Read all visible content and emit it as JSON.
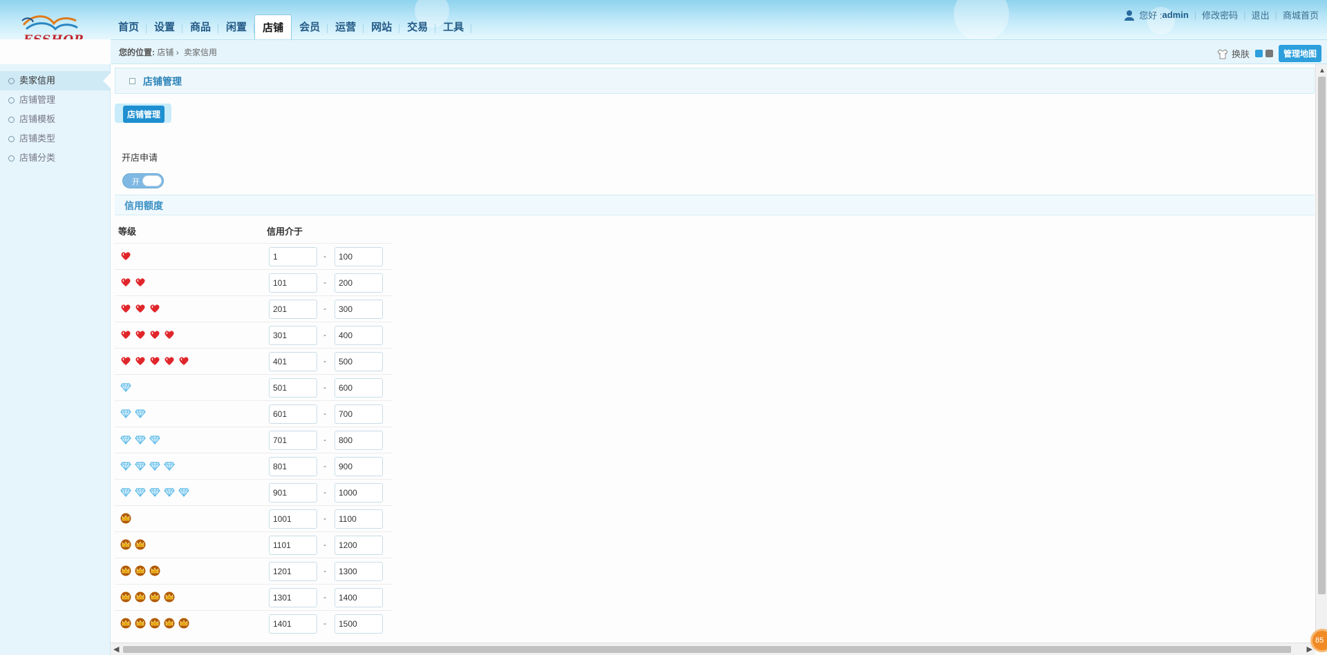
{
  "logo": {
    "text": "ESSHOP"
  },
  "nav": {
    "tabs": [
      "首页",
      "设置",
      "商品",
      "闲置",
      "店铺",
      "会员",
      "运营",
      "网站",
      "交易",
      "工具"
    ],
    "active": "店铺"
  },
  "user": {
    "greeting": "您好 : ",
    "name": "admin",
    "change_password": "修改密码",
    "logout": "退出",
    "mall_home": "商城首页"
  },
  "breadcrumb": {
    "prefix": "您的位置:",
    "level1": "店铺",
    "sep": "›",
    "level2": "卖家信用"
  },
  "toolbar": {
    "skin": "换肤",
    "map_button": "管理地图"
  },
  "sidebar": {
    "items": [
      "卖家信用",
      "店铺管理",
      "店铺模板",
      "店铺类型",
      "店铺分类"
    ],
    "active": "卖家信用"
  },
  "section": {
    "title": "店铺管理",
    "subtab": "店铺管理"
  },
  "shop_apply": {
    "label": "开店申请",
    "toggle_state": "开",
    "enabled": true
  },
  "credit": {
    "title": "信用额度",
    "col_level": "等级",
    "col_range": "信用介于",
    "dash": "-",
    "rows": [
      {
        "icon": "heart-icon",
        "count": 1,
        "min": "1",
        "max": "100"
      },
      {
        "icon": "heart-icon",
        "count": 2,
        "min": "101",
        "max": "200"
      },
      {
        "icon": "heart-icon",
        "count": 3,
        "min": "201",
        "max": "300"
      },
      {
        "icon": "heart-icon",
        "count": 4,
        "min": "301",
        "max": "400"
      },
      {
        "icon": "heart-icon",
        "count": 5,
        "min": "401",
        "max": "500"
      },
      {
        "icon": "diamond-icon",
        "count": 1,
        "min": "501",
        "max": "600"
      },
      {
        "icon": "diamond-icon",
        "count": 2,
        "min": "601",
        "max": "700"
      },
      {
        "icon": "diamond-icon",
        "count": 3,
        "min": "701",
        "max": "800"
      },
      {
        "icon": "diamond-icon",
        "count": 4,
        "min": "801",
        "max": "900"
      },
      {
        "icon": "diamond-icon",
        "count": 5,
        "min": "901",
        "max": "1000"
      },
      {
        "icon": "crown-icon",
        "count": 1,
        "min": "1001",
        "max": "1100"
      },
      {
        "icon": "crown-icon",
        "count": 2,
        "min": "1101",
        "max": "1200"
      },
      {
        "icon": "crown-icon",
        "count": 3,
        "min": "1201",
        "max": "1300"
      },
      {
        "icon": "crown-icon",
        "count": 4,
        "min": "1301",
        "max": "1400"
      },
      {
        "icon": "crown-icon",
        "count": 5,
        "min": "1401",
        "max": "1500"
      }
    ]
  },
  "badge": {
    "text": "85"
  },
  "colors": {
    "accent": "#1e8fd0",
    "heart": "#e0262b",
    "diamond": "#5ab8e6",
    "crown": "#e6a100"
  }
}
